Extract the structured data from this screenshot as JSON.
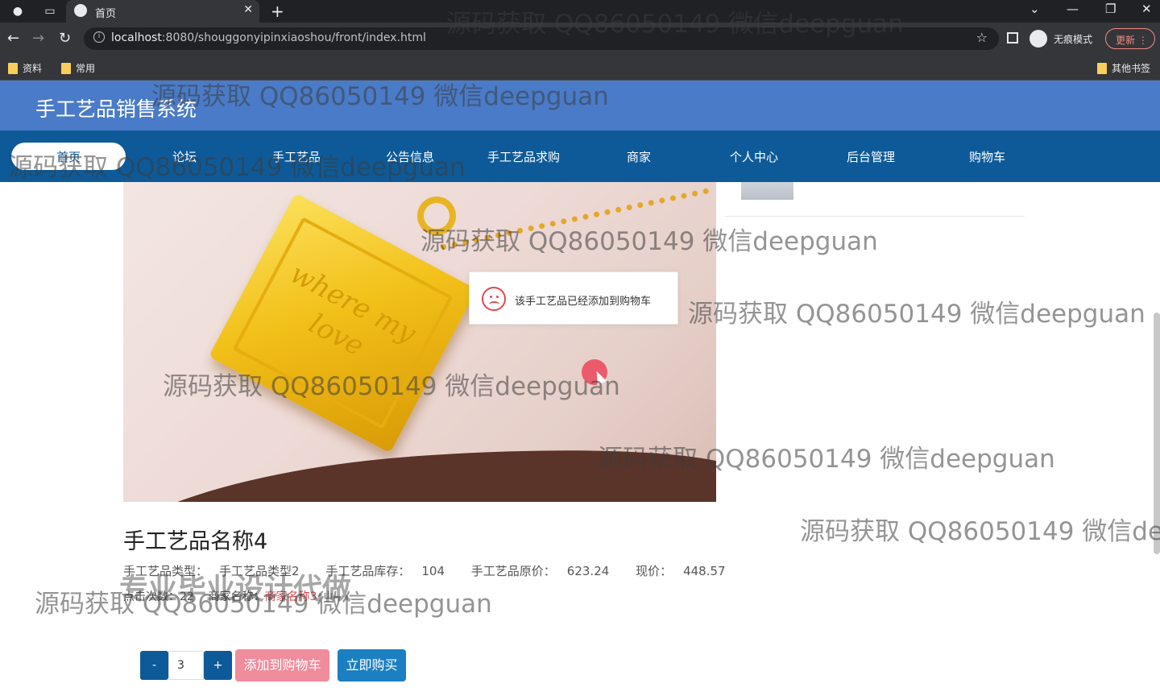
{
  "browser": {
    "tab_title": "首页",
    "url_host": "localhost",
    "url_path": ":8080/shouggonyipinxiaoshou/front/index.html",
    "incognito_label": "无痕模式",
    "update_label": "更新",
    "bookmarks": [
      "资料",
      "常用"
    ],
    "other_bookmarks": "其他书签"
  },
  "site": {
    "title": "手工艺品销售系统",
    "nav": [
      "首页",
      "论坛",
      "手工艺品",
      "公告信息",
      "手工艺品求购",
      "商家",
      "个人中心",
      "后台管理",
      "购物车"
    ]
  },
  "toast": {
    "message": "该手工艺品已经添加到购物车"
  },
  "product": {
    "image_text": "where my love",
    "name": "手工艺品名称4",
    "type_label": "手工艺品类型：",
    "type_value": "手工艺品类型2",
    "stock_label": "手工艺品库存：",
    "stock_value": "104",
    "orig_price_label": "手工艺品原价：",
    "orig_price_value": "623.24",
    "price_label": "现价：",
    "price_value": "448.57",
    "clicks_label": "点击次数：",
    "clicks_value": "22",
    "merchant_label": "商家名称：",
    "merchant_value": "商家名称3",
    "quantity": "3",
    "minus": "-",
    "plus": "+",
    "add_to_cart": "添加到购物车",
    "buy_now": "立即购买"
  },
  "watermarks": {
    "text": "源码获取 QQ86050149 微信deepguan",
    "truncated": "源码获取 QQ86050149 微信dee",
    "big": "专业毕业设计代做"
  }
}
